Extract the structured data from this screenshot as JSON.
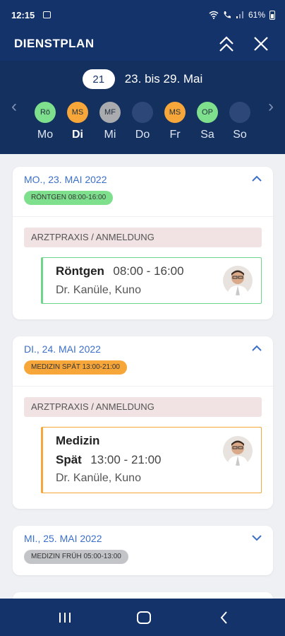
{
  "status": {
    "time": "12:15",
    "battery": "61%"
  },
  "appbar": {
    "title": "DIENSTPLAN"
  },
  "week": {
    "number": "21",
    "range": "23. bis 29. Mai",
    "days": [
      {
        "label": "Mo",
        "abbr": "Rö",
        "color": "#7ee08d"
      },
      {
        "label": "Di",
        "abbr": "MS",
        "color": "#f7a63a",
        "active": true
      },
      {
        "label": "Mi",
        "abbr": "MF",
        "color": "#a9abae"
      },
      {
        "label": "Do",
        "abbr": "",
        "color": "#2d4878"
      },
      {
        "label": "Fr",
        "abbr": "MS",
        "color": "#f7a63a"
      },
      {
        "label": "Sa",
        "abbr": "OP",
        "color": "#7ee08d"
      },
      {
        "label": "So",
        "abbr": "",
        "color": "#2d4878"
      }
    ]
  },
  "cards": [
    {
      "date": "MO., 23. MAI 2022",
      "badge": "RÖNTGEN 08:00-16:00",
      "badge_color": "#7ee08d",
      "section": "ARZTPRAXIS / ANMELDUNG",
      "shift_name": "Röntgen",
      "shift_time": "08:00 - 16:00",
      "person": "Dr. Kanüle, Kuno",
      "accent": "#6ed68a"
    },
    {
      "date": "DI., 24. MAI 2022",
      "badge": "MEDIZIN SPÄT 13:00-21:00",
      "badge_color": "#f7a63a",
      "section": "ARZTPRAXIS / ANMELDUNG",
      "shift_name_1": "Medizin",
      "shift_name_2": "Spät",
      "shift_time": "13:00 - 21:00",
      "person": "Dr. Kanüle, Kuno",
      "accent": "#f7a63a"
    },
    {
      "date": "MI., 25. MAI 2022",
      "badge": "MEDIZIN FRÜH 05:00-13:00",
      "badge_color": "#c2c4c7"
    }
  ]
}
